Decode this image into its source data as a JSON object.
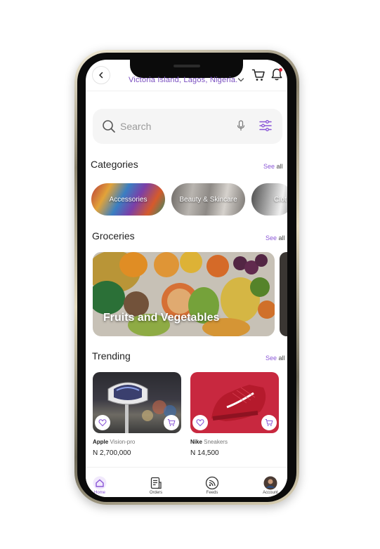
{
  "header": {
    "location": "Victoria Island, Lagos, Nigeria.",
    "icons": {
      "back": "back-arrow-icon",
      "dropdown": "chevron-down-icon",
      "cart": "cart-icon",
      "notifications": "bell-icon"
    }
  },
  "search": {
    "placeholder": "Search",
    "icons": [
      "search-icon",
      "mic-icon",
      "filter-icon"
    ]
  },
  "categories": {
    "title": "Categories",
    "see_prefix": "See",
    "see_all": "all",
    "items": [
      {
        "label": "Accessories"
      },
      {
        "label": "Beauty & Skincare"
      },
      {
        "label": "Clot"
      }
    ]
  },
  "groceries": {
    "title": "Groceries",
    "see_prefix": "See",
    "see_all": "all",
    "banner": {
      "label": "Fruits and Vegetables"
    }
  },
  "trending": {
    "title": "Trending",
    "see_prefix": "See",
    "see_all": "all",
    "products": [
      {
        "brand": "Apple",
        "model": "Vision-pro",
        "price": "N 2,700,000"
      },
      {
        "brand": "Nike",
        "model": "Sneakers",
        "price": "N 14,500"
      }
    ]
  },
  "tabbar": {
    "items": [
      {
        "label": "Home",
        "icon": "home-icon",
        "active": true
      },
      {
        "label": "Orders",
        "icon": "orders-icon"
      },
      {
        "label": "Feeds",
        "icon": "feeds-icon"
      },
      {
        "label": "Account",
        "icon": "avatar"
      }
    ]
  },
  "colors": {
    "accent": "#8a56d6",
    "location": "#7a4fc0",
    "badge": "#e0243b",
    "nike_bg": "#c8283f"
  }
}
